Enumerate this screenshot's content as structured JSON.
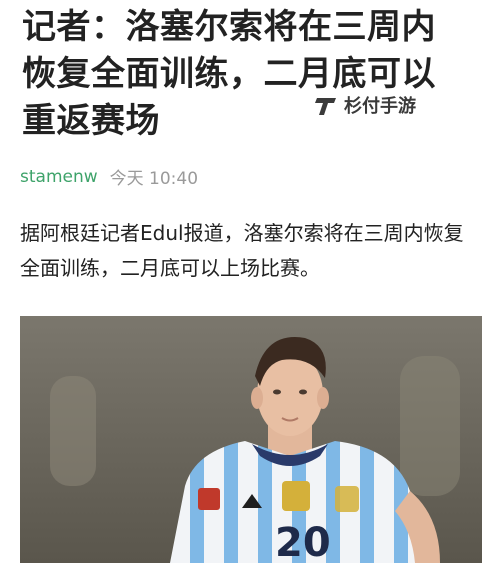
{
  "article": {
    "headline": "记者：洛塞尔索将在三周内恢复全面训练，二月底可以重返赛场",
    "author": "stamenw",
    "time": "今天 10:40",
    "body": "据阿根廷记者Edul报道，洛塞尔索将在三周内恢复全面训练，二月底可以上场比赛。",
    "image": {
      "jersey_number": "20"
    }
  },
  "watermark": {
    "text": "杉付手游",
    "icon": "stylized-t-logo-icon"
  },
  "colors": {
    "author": "#3ea36a",
    "meta_gray": "#9a9a9a",
    "headline": "#222222",
    "jersey_blue": "#7fb8e6",
    "jersey_white": "#f2f4f7"
  }
}
